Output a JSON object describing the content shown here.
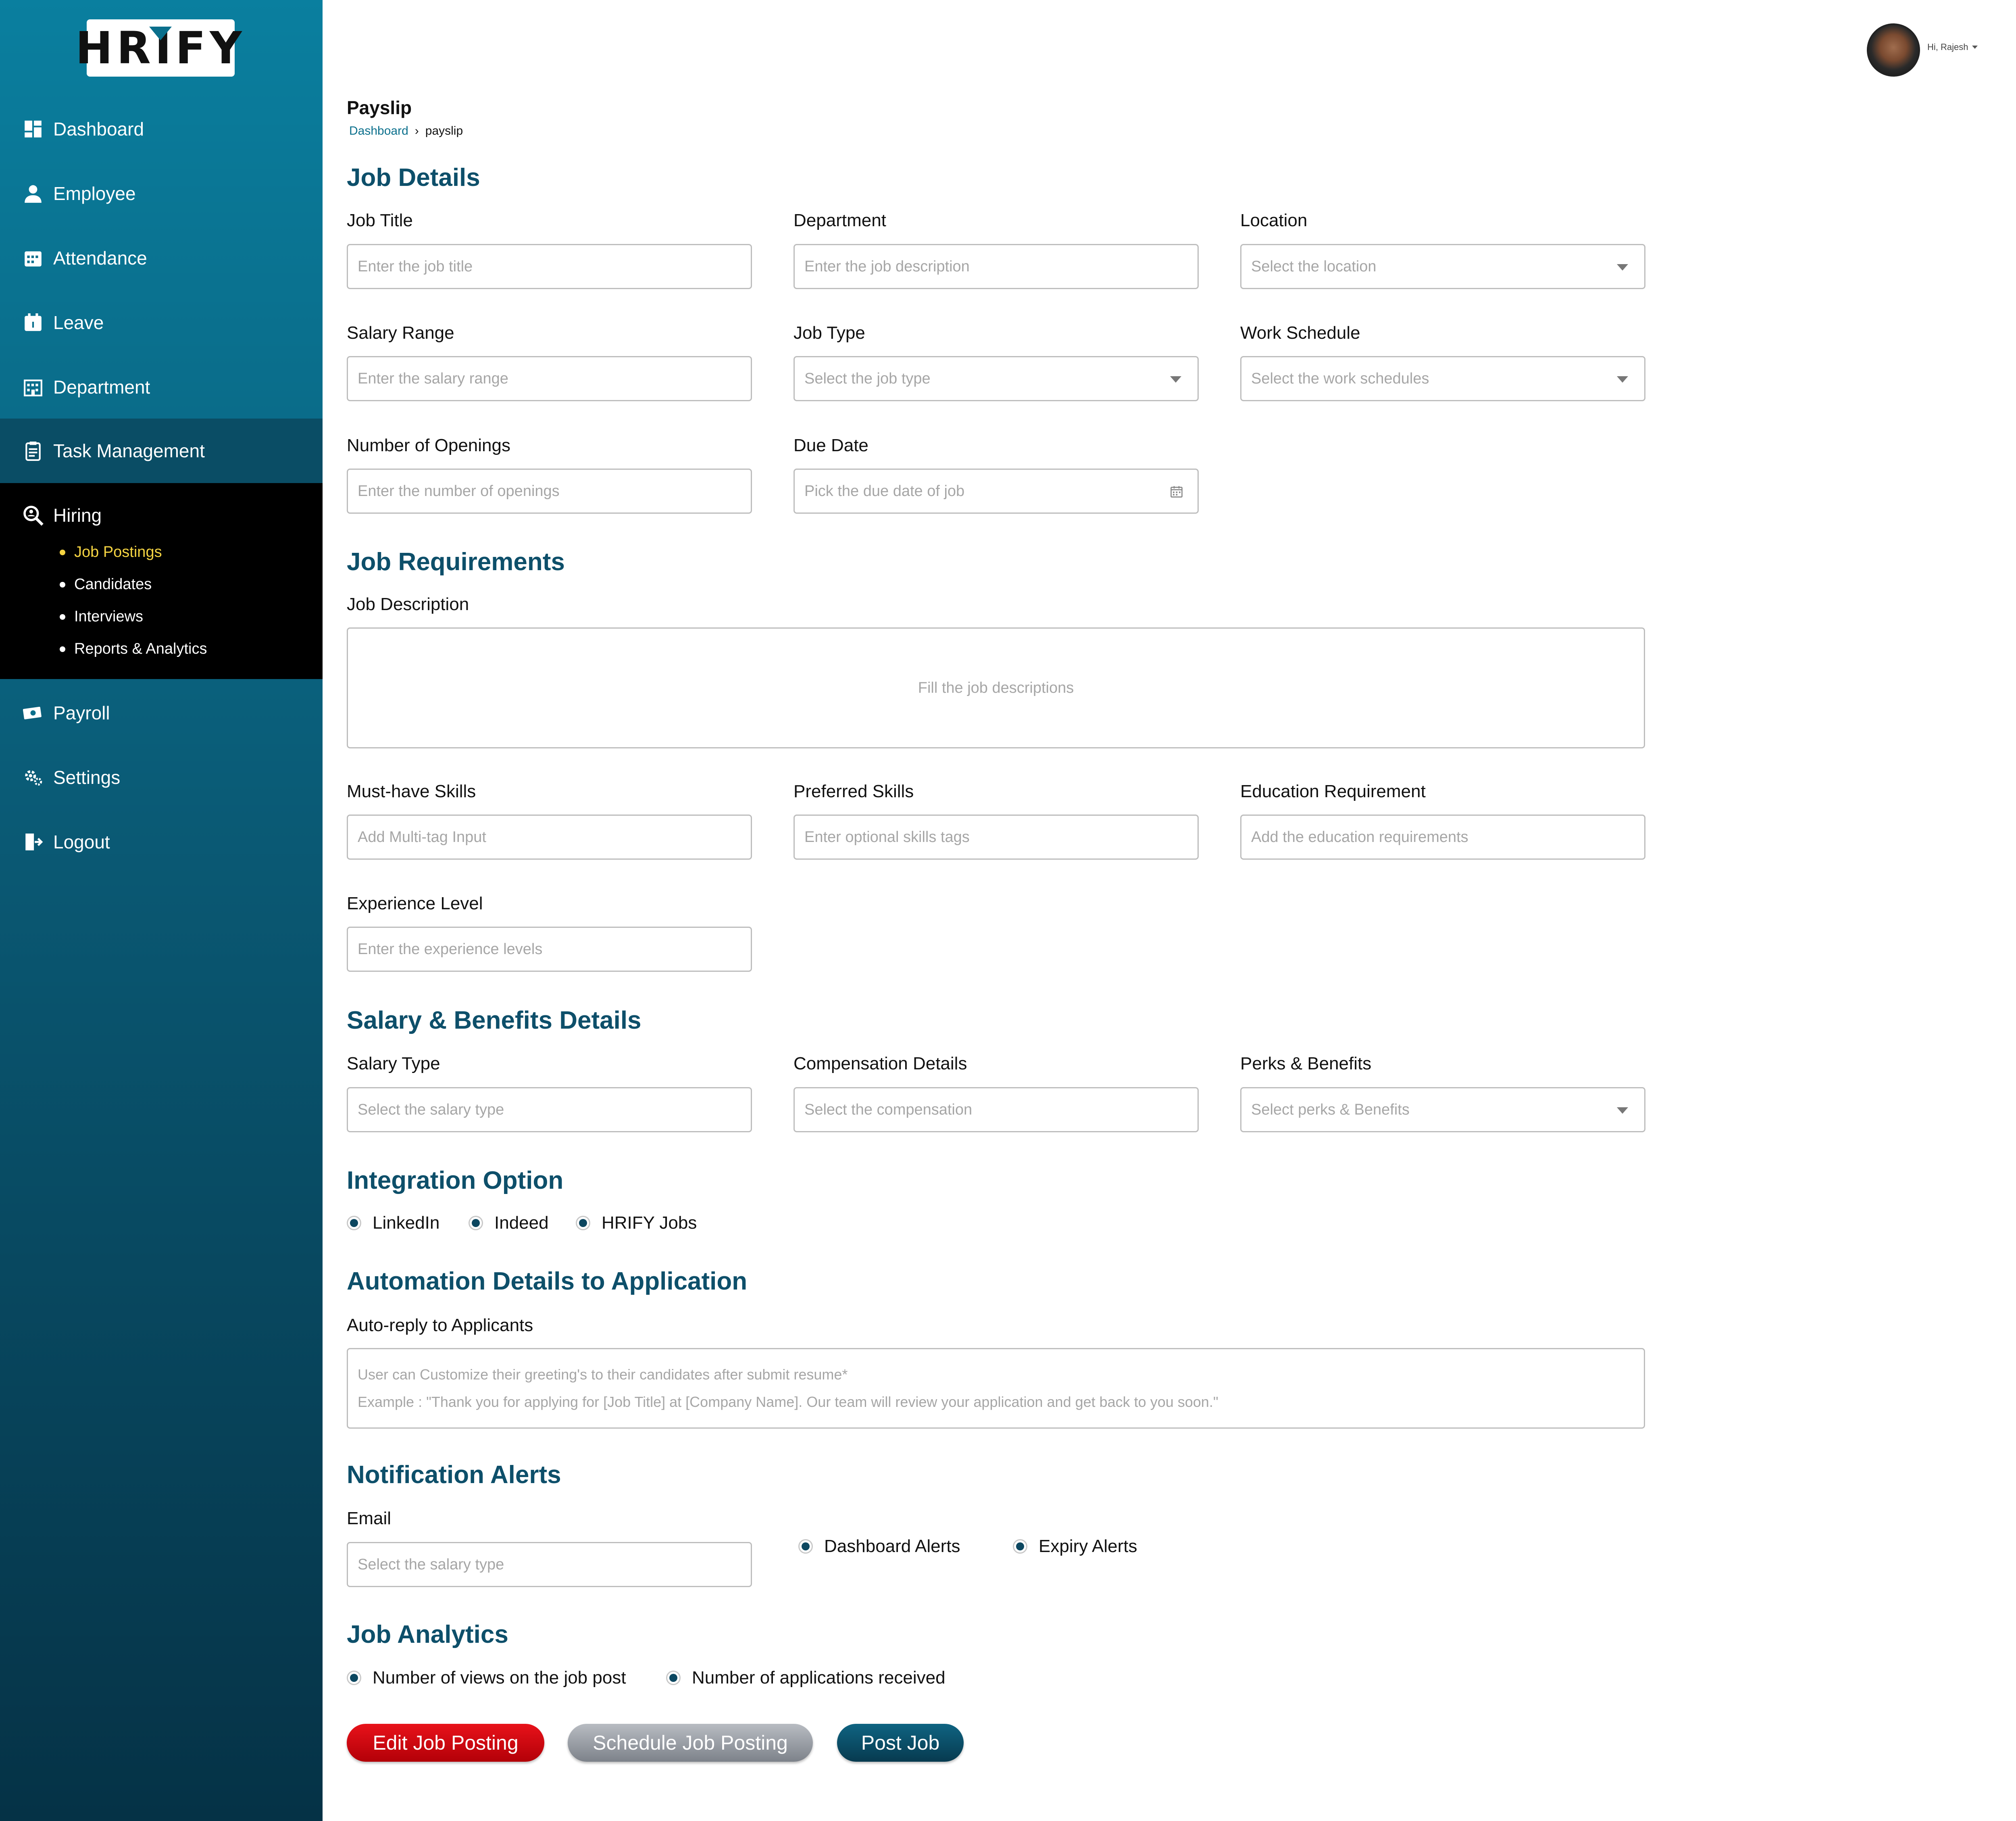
{
  "app": {
    "logo": "HRIFY"
  },
  "sidebar": {
    "items": [
      {
        "label": "Dashboard",
        "icon": "dashboard-icon"
      },
      {
        "label": "Employee",
        "icon": "employee-icon"
      },
      {
        "label": "Attendance",
        "icon": "attendance-icon"
      },
      {
        "label": "Leave",
        "icon": "leave-icon"
      },
      {
        "label": "Department",
        "icon": "department-icon"
      },
      {
        "label": "Task Management",
        "icon": "task-icon"
      },
      {
        "label": "Hiring",
        "icon": "hiring-icon"
      },
      {
        "label": "Payroll",
        "icon": "payroll-icon"
      },
      {
        "label": "Settings",
        "icon": "settings-icon"
      },
      {
        "label": "Logout",
        "icon": "logout-icon"
      }
    ],
    "hiring_sub": [
      "Job Postings",
      "Candidates",
      "Interviews",
      "Reports & Analytics"
    ],
    "selected_sub": "Job Postings"
  },
  "header": {
    "user_greeting": "Hi, Rajesh"
  },
  "page": {
    "title": "Payslip",
    "breadcrumb": {
      "link": "Dashboard",
      "current": "payslip"
    }
  },
  "job_details": {
    "heading": "Job Details",
    "job_title": {
      "label": "Job Title",
      "placeholder": "Enter the job title"
    },
    "department": {
      "label": "Department",
      "placeholder": "Enter the job description"
    },
    "location": {
      "label": "Location",
      "placeholder": "Select the location"
    },
    "salary_range": {
      "label": "Salary Range",
      "placeholder": "Enter the salary range"
    },
    "job_type": {
      "label": "Job Type",
      "placeholder": "Select the job type"
    },
    "work_schedule": {
      "label": "Work Schedule",
      "placeholder": "Select the work schedules"
    },
    "openings": {
      "label": "Number of Openings",
      "placeholder": "Enter the number of openings"
    },
    "due_date": {
      "label": "Due Date",
      "placeholder": "Pick the due date of job"
    }
  },
  "job_requirements": {
    "heading": "Job Requirements",
    "description": {
      "label": "Job Description",
      "placeholder": "Fill the job descriptions"
    },
    "must_have": {
      "label": "Must-have Skills",
      "placeholder": "Add Multi-tag Input"
    },
    "preferred": {
      "label": "Preferred Skills",
      "placeholder": "Enter optional skills tags"
    },
    "education": {
      "label": "Education Requirement",
      "placeholder": "Add the education requirements"
    },
    "experience": {
      "label": "Experience Level",
      "placeholder": "Enter the experience levels"
    }
  },
  "salary_benefits": {
    "heading": "Salary & Benefits Details",
    "salary_type": {
      "label": "Salary Type",
      "placeholder": "Select the salary type"
    },
    "compensation": {
      "label": "Compensation Details",
      "placeholder": "Select the compensation"
    },
    "perks": {
      "label": "Perks & Benefits",
      "placeholder": "Select perks & Benefits"
    }
  },
  "integration": {
    "heading": "Integration Option",
    "options": [
      "LinkedIn",
      "Indeed",
      "HRIFY Jobs"
    ]
  },
  "automation": {
    "heading": "Automation Details to Application",
    "auto_reply_label": "Auto-reply to Applicants",
    "placeholder_line1": "User can Customize their greeting's to their candidates after submit resume*",
    "placeholder_line2": "Example : \"Thank you for applying for [Job Title] at [Company Name]. Our team will review your application and get back to you soon.\""
  },
  "notifications": {
    "heading": "Notification Alerts",
    "email": {
      "label": "Email",
      "placeholder": "Select the salary type"
    },
    "options": [
      "Dashboard Alerts",
      "Expiry Alerts"
    ]
  },
  "analytics": {
    "heading": "Job Analytics",
    "options": [
      "Number of views on the job post",
      "Number of applications received"
    ]
  },
  "actions": {
    "edit": "Edit Job Posting",
    "schedule": "Schedule Job Posting",
    "post": "Post Job"
  },
  "colors": {
    "accent": "#0d4f6a",
    "selected_sub": "#f5d442",
    "danger": "#e8121a"
  }
}
